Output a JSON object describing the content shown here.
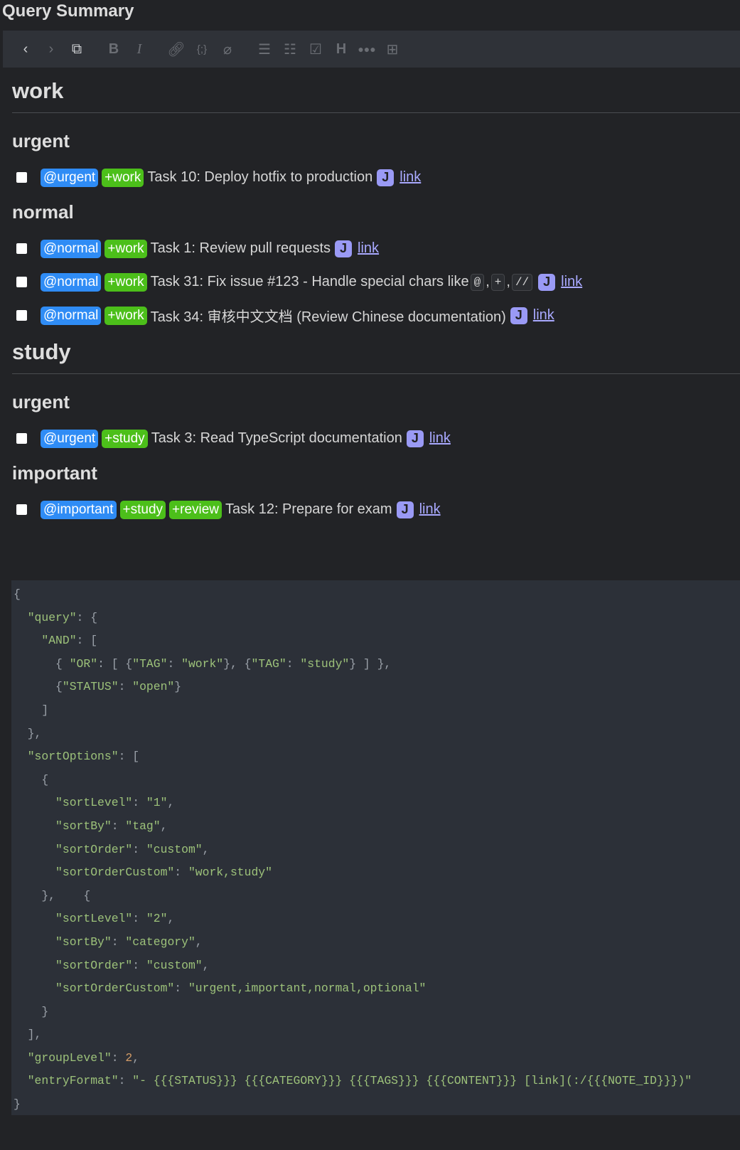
{
  "title": "Query Summary",
  "toolbar": [
    "back",
    "forward",
    "external-edit",
    "bold",
    "italic",
    "link",
    "code",
    "attach",
    "bullet-list",
    "numbered-list",
    "checklist",
    "heading",
    "more",
    "insert-time"
  ],
  "sections": [
    {
      "title": "work",
      "groups": [
        {
          "title": "urgent",
          "tasks": [
            {
              "cat": "@urgent",
              "tags": [
                "+work"
              ],
              "text": "Task 10: Deploy hotfix to production",
              "link": "link"
            }
          ]
        },
        {
          "title": "normal",
          "tasks": [
            {
              "cat": "@normal",
              "tags": [
                "+work"
              ],
              "text": "Task 1: Review pull requests",
              "link": "link"
            },
            {
              "cat": "@normal",
              "tags": [
                "+work"
              ],
              "text": "Task 31: Fix issue #123 - Handle special chars like",
              "inline": [
                "@",
                "+",
                "//"
              ],
              "link": "link"
            },
            {
              "cat": "@normal",
              "tags": [
                "+work"
              ],
              "text": "Task 34: 审核中文文档 (Review Chinese documentation)",
              "link": "link"
            }
          ]
        }
      ]
    },
    {
      "title": "study",
      "groups": [
        {
          "title": "urgent",
          "tasks": [
            {
              "cat": "@urgent",
              "tags": [
                "+study"
              ],
              "text": "Task 3: Read TypeScript documentation",
              "link": "link"
            }
          ]
        },
        {
          "title": "important",
          "tasks": [
            {
              "cat": "@important",
              "tags": [
                "+study",
                "+review"
              ],
              "text": "Task 12: Prepare for exam",
              "link": "link"
            }
          ]
        }
      ]
    }
  ],
  "code": [
    "{",
    "  \"query\": {",
    "    \"AND\": [",
    "      { \"OR\": [ {\"TAG\": \"work\"}, {\"TAG\": \"study\"} ] },",
    "      {\"STATUS\": \"open\"}",
    "    ]",
    "  },",
    "  \"sortOptions\": [",
    "    {",
    "      \"sortLevel\": \"1\",",
    "      \"sortBy\": \"tag\",",
    "      \"sortOrder\": \"custom\",",
    "      \"sortOrderCustom\": \"work,study\"",
    "    },    {",
    "      \"sortLevel\": \"2\",",
    "      \"sortBy\": \"category\",",
    "      \"sortOrder\": \"custom\",",
    "      \"sortOrderCustom\": \"urgent,important,normal,optional\"",
    "    }",
    "  ],",
    "  \"groupLevel\": 2,",
    "  \"entryFormat\": \"- {{{STATUS}}} {{{CATEGORY}}} {{{TAGS}}} {{{CONTENT}}} [link](:/{{{NOTE_ID}}})\"",
    "}"
  ]
}
